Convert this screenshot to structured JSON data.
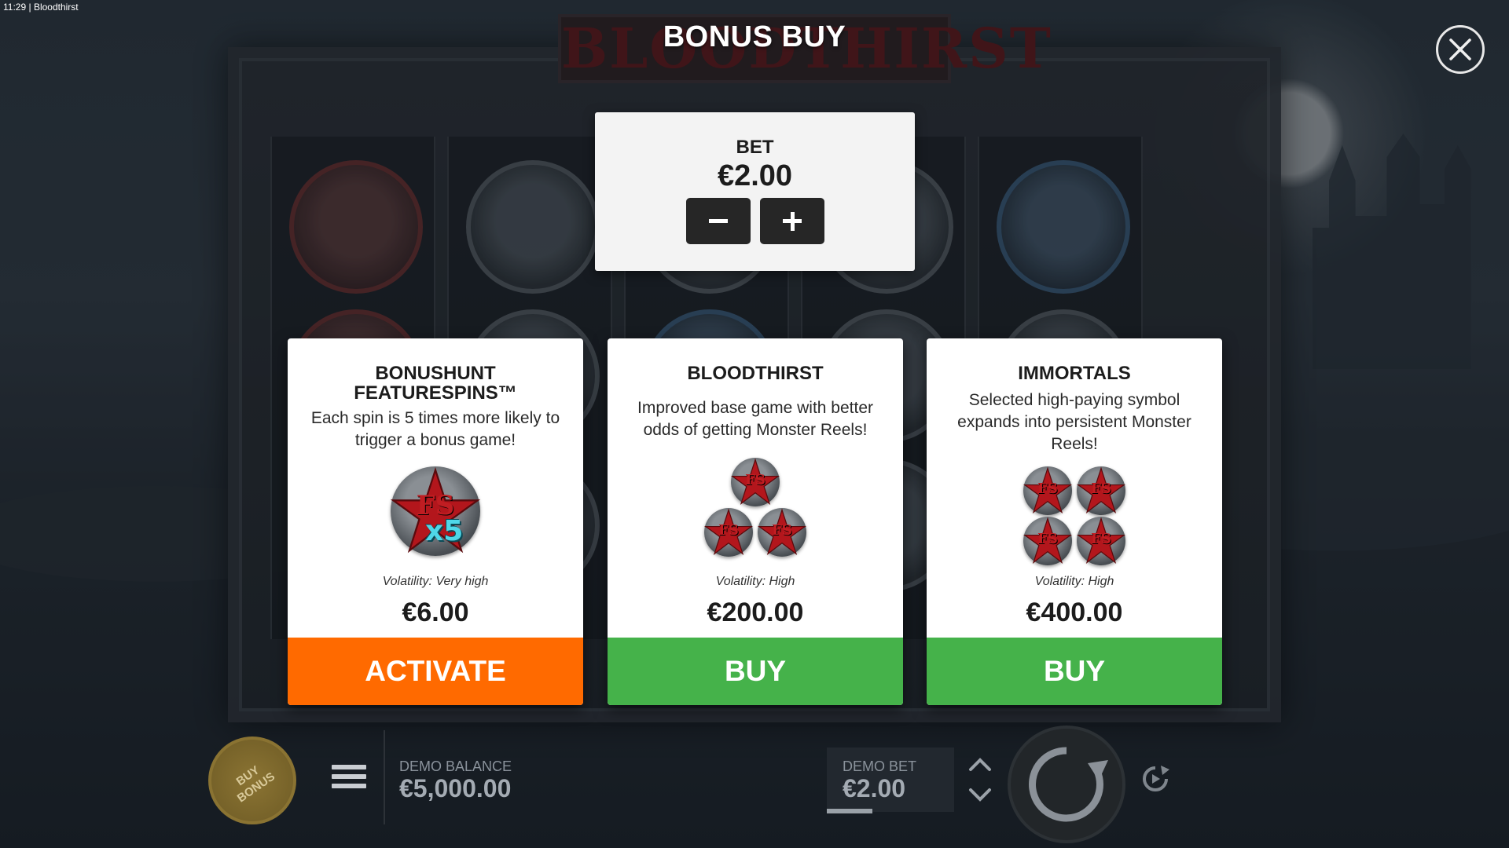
{
  "status_bar": {
    "time": "11:29",
    "app_name": "Bloodthirst"
  },
  "background": {
    "game_logo": "BLOODTHIRST"
  },
  "modal": {
    "title": "BONUS BUY",
    "close_icon": "close-icon"
  },
  "bet_panel": {
    "label": "BET",
    "value": "€2.00",
    "decrease_icon": "minus-icon",
    "increase_icon": "plus-icon"
  },
  "cards": [
    {
      "title_line1": "BONUSHUNT",
      "title_line2": "FEATURESPINS™",
      "description": "Each spin is 5 times more likely to trigger a bonus game!",
      "badge_text": "FS",
      "multiplier_text": "x5",
      "volatility": "Volatility: Very high",
      "price": "€6.00",
      "action": "ACTIVATE",
      "action_color": "#ff6a00"
    },
    {
      "title": "BLOODTHIRST",
      "description": "Improved base game with better odds of getting Monster Reels!",
      "badge_text": "FS",
      "volatility": "Volatility: High",
      "price": "€200.00",
      "action": "BUY",
      "action_color": "#45b24a"
    },
    {
      "title": "IMMORTALS",
      "description": "Selected high-paying symbol expands into persistent Monster Reels!",
      "badge_text": "FS",
      "volatility": "Volatility: High",
      "price": "€400.00",
      "action": "BUY",
      "action_color": "#45b24a"
    }
  ],
  "bottom_bar": {
    "buy_bonus_label_line1": "BUY",
    "buy_bonus_label_line2": "BONUS",
    "balance_label": "DEMO BALANCE",
    "balance_value": "€5,000.00",
    "bet_label": "DEMO BET",
    "bet_value": "€2.00",
    "icons": {
      "menu": "hamburger-menu-icon",
      "spin": "spin-icon",
      "autoplay": "autoplay-icon",
      "bet_up": "chevron-up-icon",
      "bet_down": "chevron-down-icon"
    }
  },
  "colors": {
    "activate": "#ff6a00",
    "buy": "#45b24a",
    "panel_bg": "#f3f3f3",
    "badge_red": "#c01d22",
    "multiplier_cyan": "#4fd7e8"
  }
}
